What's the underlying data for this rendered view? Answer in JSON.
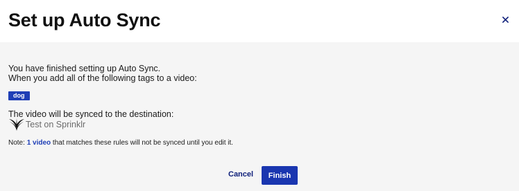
{
  "header": {
    "title": "Set up Auto Sync",
    "close_icon": "close-icon"
  },
  "body": {
    "line1": "You have finished setting up Auto Sync.",
    "line2": "When you add all of the following tags to a video:",
    "tags": [
      "dog"
    ],
    "destination_label": "The video will be synced to the destination:",
    "destination": {
      "icon": "sprinklr-logo-icon",
      "name": "Test on Sprinklr"
    },
    "note": {
      "prefix": "Note: ",
      "link": "1 video",
      "suffix": " that matches these rules will not be synced until you edit it."
    }
  },
  "footer": {
    "cancel_label": "Cancel",
    "finish_label": "Finish"
  },
  "colors": {
    "accent": "#1a36b0",
    "tag_bg": "#1f3fb6",
    "header_bg": "#ffffff",
    "body_bg": "#f5f5f5"
  }
}
